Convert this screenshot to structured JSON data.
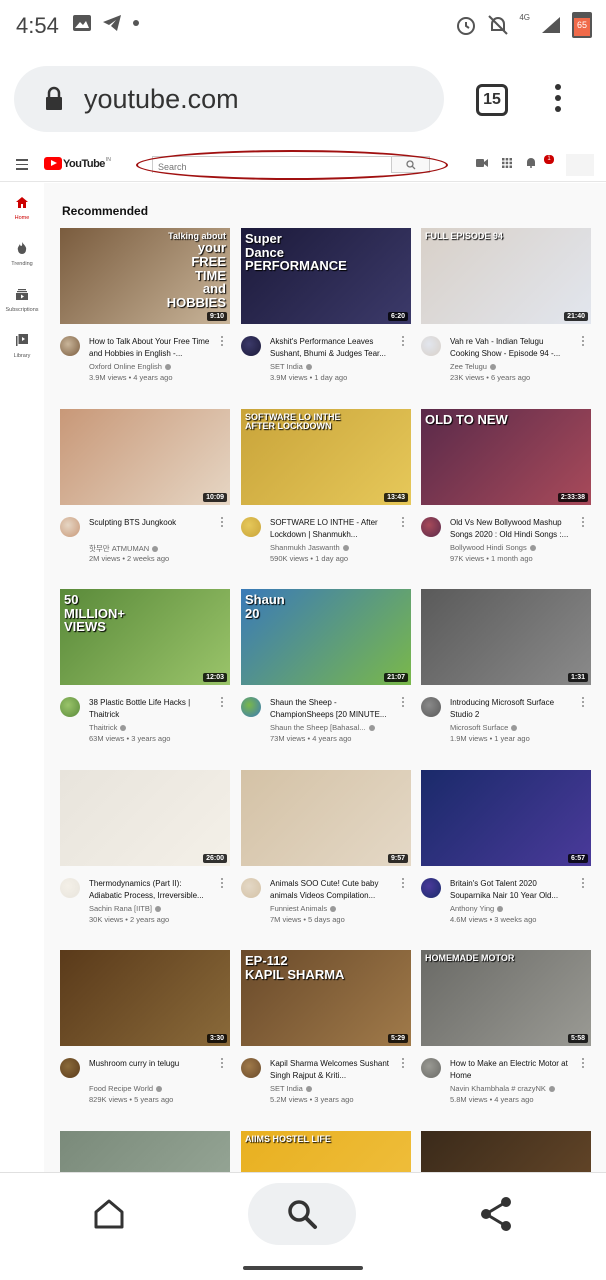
{
  "status_bar": {
    "time": "4:54",
    "network": "4G",
    "battery": "65"
  },
  "browser": {
    "url": "youtube.com",
    "tab_count": "15"
  },
  "youtube": {
    "logo_text": "YouTube",
    "logo_region": "IN",
    "search_placeholder": "Search",
    "notification_count": "1",
    "section_title": "Recommended",
    "sidebar": [
      {
        "label": "Home"
      },
      {
        "label": "Trending"
      },
      {
        "label": "Subscriptions"
      },
      {
        "label": "Library"
      }
    ],
    "videos": [
      {
        "title": "How to Talk About Your Free Time and Hobbies in English -...",
        "channel": "Oxford Online English",
        "meta": "3.9M views • 4 years ago",
        "duration": "9:10",
        "thumb_text": [
          "Talking about",
          "your",
          "FREE",
          "TIME",
          "and",
          "HOBBIES"
        ],
        "colors": [
          "#7a5c3e",
          "#c9b59a"
        ]
      },
      {
        "title": "Akshit's Performance Leaves Sushant, Bhumi & Judges Tear...",
        "channel": "SET India",
        "meta": "3.9M views • 1 day ago",
        "duration": "6:20",
        "thumb_text": [
          "Super",
          "Dance",
          "PERFORMANCE"
        ],
        "colors": [
          "#1c1a3a",
          "#3c3a6a"
        ]
      },
      {
        "title": "Vah re Vah - Indian Telugu Cooking Show - Episode 94 -...",
        "channel": "Zee Telugu",
        "meta": "23K views • 6 years ago",
        "duration": "21:40",
        "thumb_text": [
          "FULL EPISODE 94"
        ],
        "colors": [
          "#d8d0c8",
          "#e2e6ee"
        ]
      },
      {
        "title": "Sculpting BTS Jungkook",
        "channel": "핫무만 ATMUMAN",
        "meta": "2M views • 2 weeks ago",
        "duration": "10:09",
        "thumb_text": [],
        "colors": [
          "#c89878",
          "#e6d6c4"
        ]
      },
      {
        "title": "SOFTWARE LO INTHE - After Lockdown | Shanmukh...",
        "channel": "Shanmukh Jaswanth",
        "meta": "590K views • 1 day ago",
        "duration": "13:43",
        "thumb_text": [
          "SOFTWARE LO INTHE",
          "AFTER LOCKDOWN"
        ],
        "colors": [
          "#c9a43a",
          "#e6c85a"
        ]
      },
      {
        "title": "Old Vs New Bollywood Mashup Songs 2020 : Old Hindi Songs :...",
        "channel": "Bollywood Hindi Songs",
        "meta": "97K views • 1 month ago",
        "duration": "2:33:38",
        "thumb_text": [
          "OLD TO NEW"
        ],
        "colors": [
          "#5a2a4a",
          "#a84a5a"
        ]
      },
      {
        "title": "38 Plastic Bottle Life Hacks | Thaitrick",
        "channel": "Thaitrick",
        "meta": "63M views • 3 years ago",
        "duration": "12:03",
        "thumb_text": [
          "50",
          "MILLION+",
          "VIEWS"
        ],
        "colors": [
          "#5a8a3a",
          "#9ac46a"
        ]
      },
      {
        "title": "Shaun the Sheep - ChampionSheeps [20 MINUTE...",
        "channel": "Shaun the Sheep [Bahasal...",
        "meta": "73M views • 4 years ago",
        "duration": "21:07",
        "thumb_text": [
          "Shaun",
          "20"
        ],
        "colors": [
          "#3a7ab8",
          "#7ab84a"
        ]
      },
      {
        "title": "Introducing Microsoft Surface Studio 2",
        "channel": "Microsoft Surface",
        "meta": "1.9M views • 1 year ago",
        "duration": "1:31",
        "thumb_text": [],
        "colors": [
          "#5a5a5a",
          "#8a8a8a"
        ]
      },
      {
        "title": "Thermodynamics (Part II): Adiabatic Process, Irreversible...",
        "channel": "Sachin Rana [IITB]",
        "meta": "30K views • 2 years ago",
        "duration": "26:00",
        "thumb_text": [],
        "colors": [
          "#e8e4dc",
          "#f4f0e8"
        ]
      },
      {
        "title": "Animals SOO Cute! Cute baby animals Videos Compilation...",
        "channel": "Funniest Animals",
        "meta": "7M views • 5 days ago",
        "duration": "9:57",
        "thumb_text": [],
        "colors": [
          "#d4c2a6",
          "#e4d8c6"
        ]
      },
      {
        "title": "Britain's Got Talent 2020 Souparnika Nair 10 Year Old...",
        "channel": "Anthony Ying",
        "meta": "4.6M views • 3 weeks ago",
        "duration": "6:57",
        "thumb_text": [],
        "colors": [
          "#1a2a6a",
          "#4a3a9a"
        ]
      },
      {
        "title": "Mushroom curry in telugu",
        "channel": "Food Recipe World",
        "meta": "829K views • 5 years ago",
        "duration": "3:30",
        "thumb_text": [],
        "colors": [
          "#5a3a1a",
          "#8a6a3a"
        ]
      },
      {
        "title": "Kapil Sharma Welcomes Sushant Singh Rajput & Kriti...",
        "channel": "SET India",
        "meta": "5.2M views • 3 years ago",
        "duration": "5:29",
        "thumb_text": [
          "EP-112",
          "KAPIL SHARMA"
        ],
        "colors": [
          "#6a4a2a",
          "#a07a4a"
        ]
      },
      {
        "title": "How to Make an Electric Motor at Home",
        "channel": "Navin Khambhala # crazyNK",
        "meta": "5.8M views • 4 years ago",
        "duration": "5:58",
        "thumb_text": [
          "HOMEMADE MOTOR"
        ],
        "colors": [
          "#6a6a66",
          "#9a9a94"
        ]
      },
      {
        "title": "",
        "channel": "",
        "meta": "",
        "duration": "",
        "thumb_text": [],
        "colors": [
          "#7a8a7a",
          "#9aaa9a"
        ]
      },
      {
        "title": "",
        "channel": "",
        "meta": "",
        "duration": "",
        "thumb_text": [
          "AIIMS HOSTEL LIFE"
        ],
        "colors": [
          "#e8b020",
          "#f0c040"
        ]
      },
      {
        "title": "",
        "channel": "",
        "meta": "",
        "duration": "",
        "thumb_text": [],
        "colors": [
          "#3a2a1a",
          "#6a4a2a"
        ]
      }
    ]
  },
  "colors": {
    "yt_red": "#ff0000",
    "annotation": "#a01010",
    "background": "#f9f9f9"
  }
}
